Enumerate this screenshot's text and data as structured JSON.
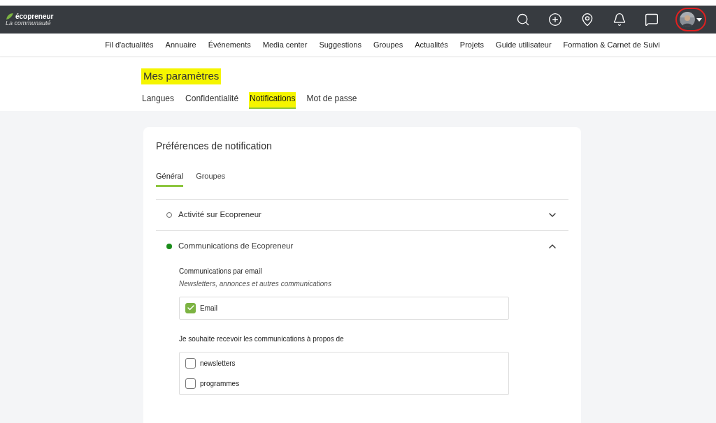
{
  "logo": {
    "name": "écopreneur",
    "tagline": "La communauté"
  },
  "top_icons": [
    {
      "kind": "search"
    },
    {
      "kind": "plus"
    },
    {
      "kind": "pin"
    },
    {
      "kind": "bell"
    },
    {
      "kind": "chat"
    }
  ],
  "avatar": {
    "kind": "picture",
    "circled": true
  },
  "nav": [
    "Fil d'actualités",
    "Annuaire",
    "Événements",
    "Media center",
    "Suggestions",
    "Groupes",
    "Actualités",
    "Projets",
    "Guide utilisateur",
    "Formation & Carnet de Suivi"
  ],
  "page_title": {
    "text": "Mes paramètres",
    "highlighted": true
  },
  "settings_tabs": [
    {
      "label": "Langues",
      "selected": false,
      "highlighted": false
    },
    {
      "label": "Confidentialité",
      "selected": false,
      "highlighted": false
    },
    {
      "label": "Notifications",
      "selected": true,
      "highlighted": true
    },
    {
      "label": "Mot de passe",
      "selected": false,
      "highlighted": false
    }
  ],
  "card": {
    "title": "Préférences de notification",
    "tabs": [
      {
        "label": "Général",
        "selected": true
      },
      {
        "label": "Groupes",
        "selected": false
      }
    ],
    "sections": [
      {
        "title": "Activité sur Ecopreneur",
        "active": false,
        "expanded": false
      },
      {
        "title": "Communications de Ecopreneur",
        "active": true,
        "expanded": true,
        "groups": [
          {
            "label": "Communications par email",
            "hint": "Newsletters, annonces et autres communications",
            "options": [
              {
                "label": "Email",
                "checked": true
              }
            ]
          },
          {
            "label": "Je souhaite recevoir les communications à propos de",
            "options": [
              {
                "label": "newsletters",
                "checked": false
              },
              {
                "label": "programmes",
                "checked": false
              }
            ]
          }
        ]
      }
    ]
  }
}
